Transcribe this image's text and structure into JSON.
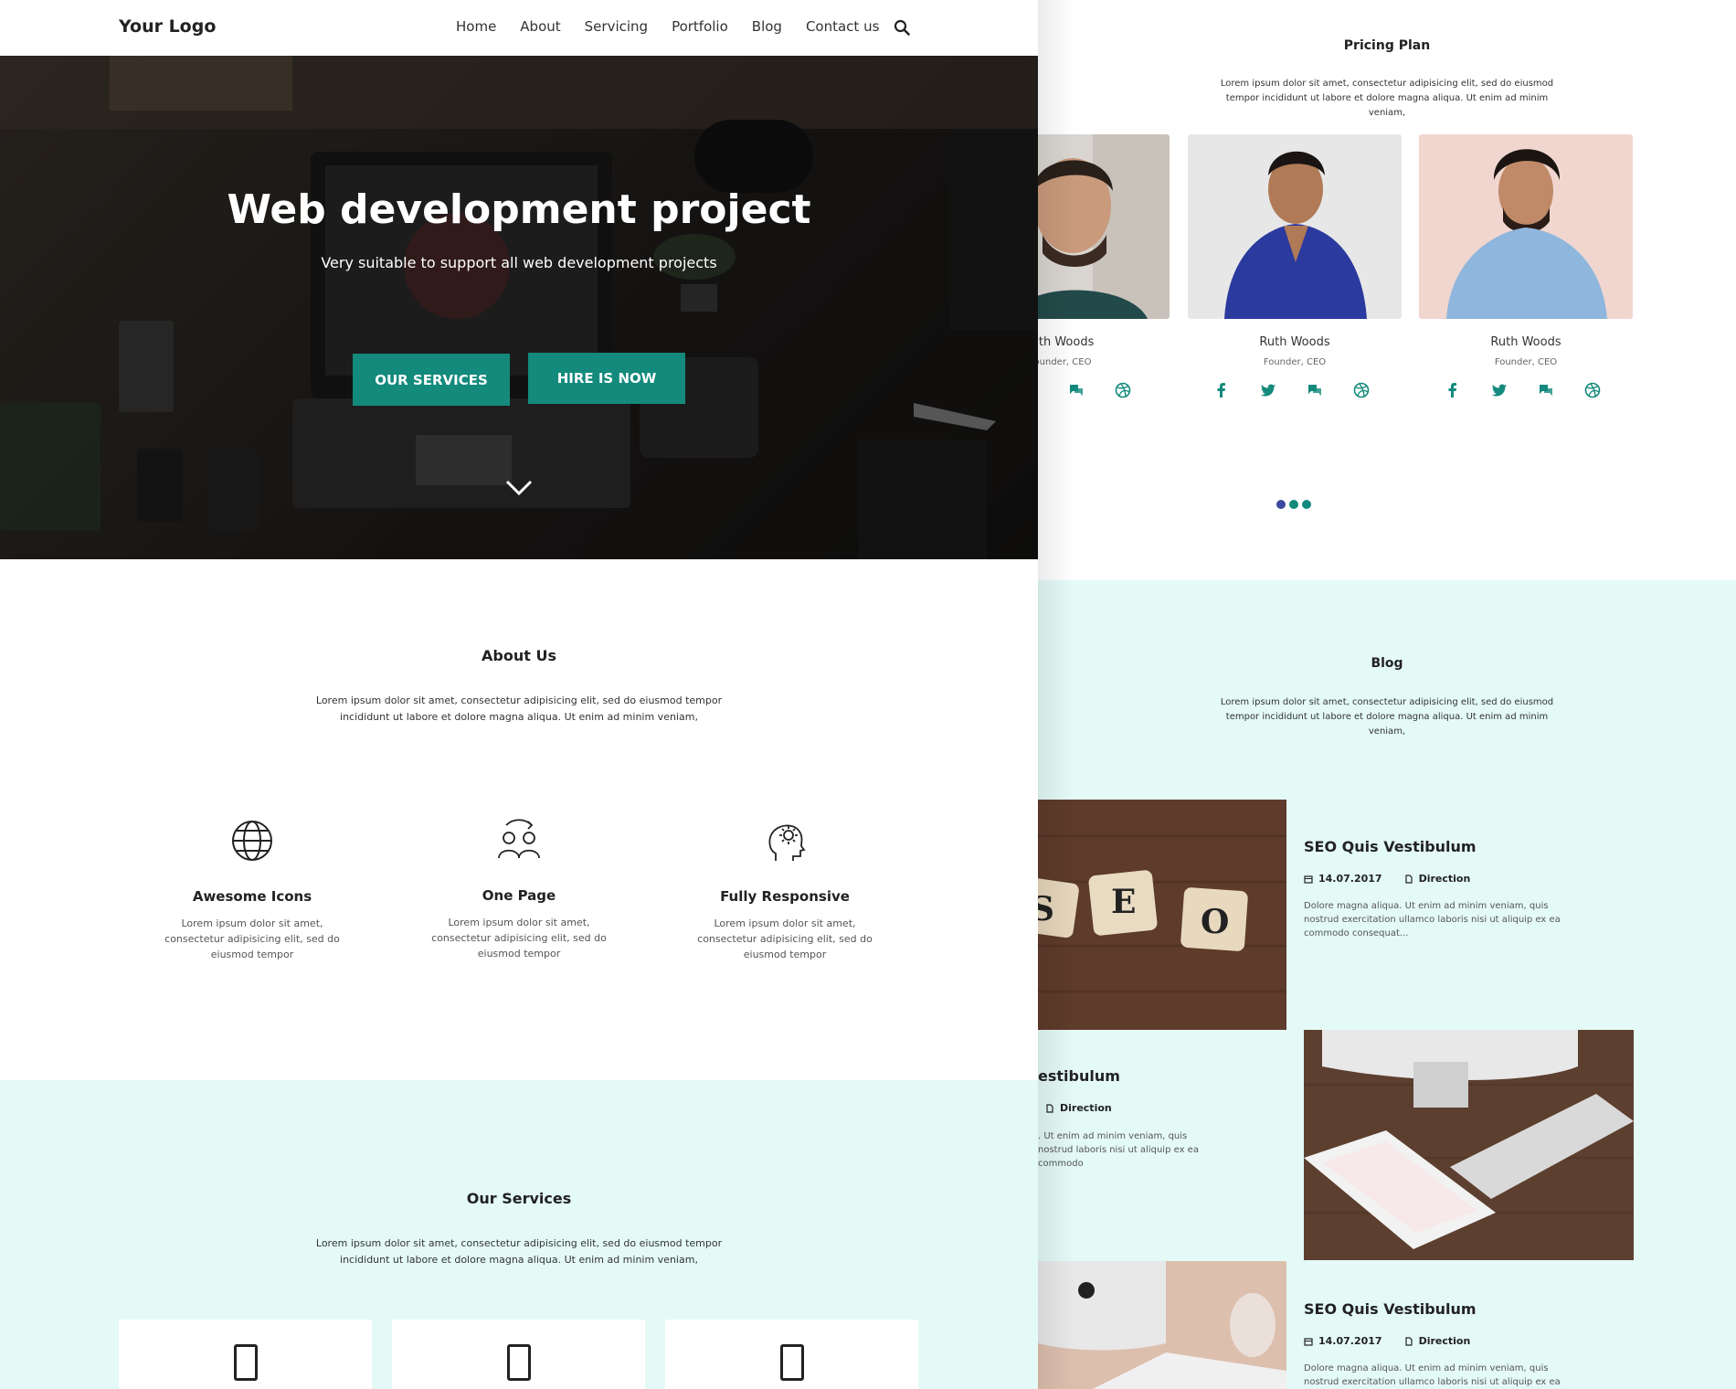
{
  "nav": {
    "logo": "Your Logo",
    "links": [
      "Home",
      "About",
      "Servicing",
      "Portfolio",
      "Blog",
      "Contact us"
    ]
  },
  "hero": {
    "title": "Web development project",
    "subtitle": "Very suitable to support all web development projects",
    "btn_services": "OUR SERVICES",
    "btn_hire": "HIRE IS NOW"
  },
  "about": {
    "title": "About Us",
    "text": "Lorem ipsum dolor sit amet, consectetur adipisicing elit, sed do eiusmod tempor incididunt ut labore et dolore magna aliqua. Ut enim ad minim veniam,",
    "features": [
      {
        "icon": "globe-icon",
        "title": "Awesome Icons",
        "text": "Lorem ipsum dolor sit amet, consectetur adipisicing elit, sed do eiusmod tempor"
      },
      {
        "icon": "users-sync-icon",
        "title": "One Page",
        "text": "Lorem ipsum dolor sit amet, consectetur adipisicing elit, sed do eiusmod tempor"
      },
      {
        "icon": "head-gear-icon",
        "title": "Fully Responsive",
        "text": "Lorem ipsum dolor sit amet, consectetur adipisicing elit, sed do eiusmod tempor"
      }
    ]
  },
  "services": {
    "title": "Our Services",
    "text": "Lorem ipsum dolor sit amet, consectetur adipisicing elit, sed do eiusmod tempor incididunt ut labore et dolore magna aliqua. Ut enim ad minim veniam,"
  },
  "pricing": {
    "title": "Pricing Plan",
    "text": "Lorem ipsum dolor sit amet, consectetur adipisicing elit, sed do eiusmod tempor incididunt ut labore et dolore magna aliqua. Ut enim ad minim veniam,",
    "people": [
      {
        "name": "uth Woods",
        "role": "ounder, CEO"
      },
      {
        "name": "Ruth Woods",
        "role": "Founder, CEO"
      },
      {
        "name": "Ruth Woods",
        "role": "Founder, CEO"
      }
    ]
  },
  "blog": {
    "title": "Blog",
    "text": "Lorem ipsum dolor sit amet, consectetur adipisicing elit, sed do eiusmod tempor incididunt ut labore et dolore magna aliqua. Ut enim ad minim veniam,",
    "post1": {
      "title": "SEO Quis Vestibulum",
      "date": "14.07.2017",
      "category": "Direction",
      "text": "Dolore magna aliqua. Ut enim ad minim veniam, quis nostrud exercitation ullamco laboris nisi ut aliquip ex ea commodo consequat..."
    },
    "post2": {
      "title": "estibulum",
      "category": "Direction",
      "text": ". Ut enim ad minim veniam, quis nostrud laboris nisi ut aliquip ex ea commodo"
    },
    "post3": {
      "title": "SEO Quis Vestibulum",
      "date": "14.07.2017",
      "category": "Direction",
      "text": "Dolore magna aliqua. Ut enim ad minim veniam, quis nostrud exercitation ullamco laboris nisi ut aliquip ex ea commodo"
    },
    "tiles": [
      "S",
      "E",
      "O"
    ]
  },
  "colors": {
    "accent": "#138a7c",
    "mint_bg": "#e4faf7",
    "dot_active": "#3a4aa0"
  }
}
